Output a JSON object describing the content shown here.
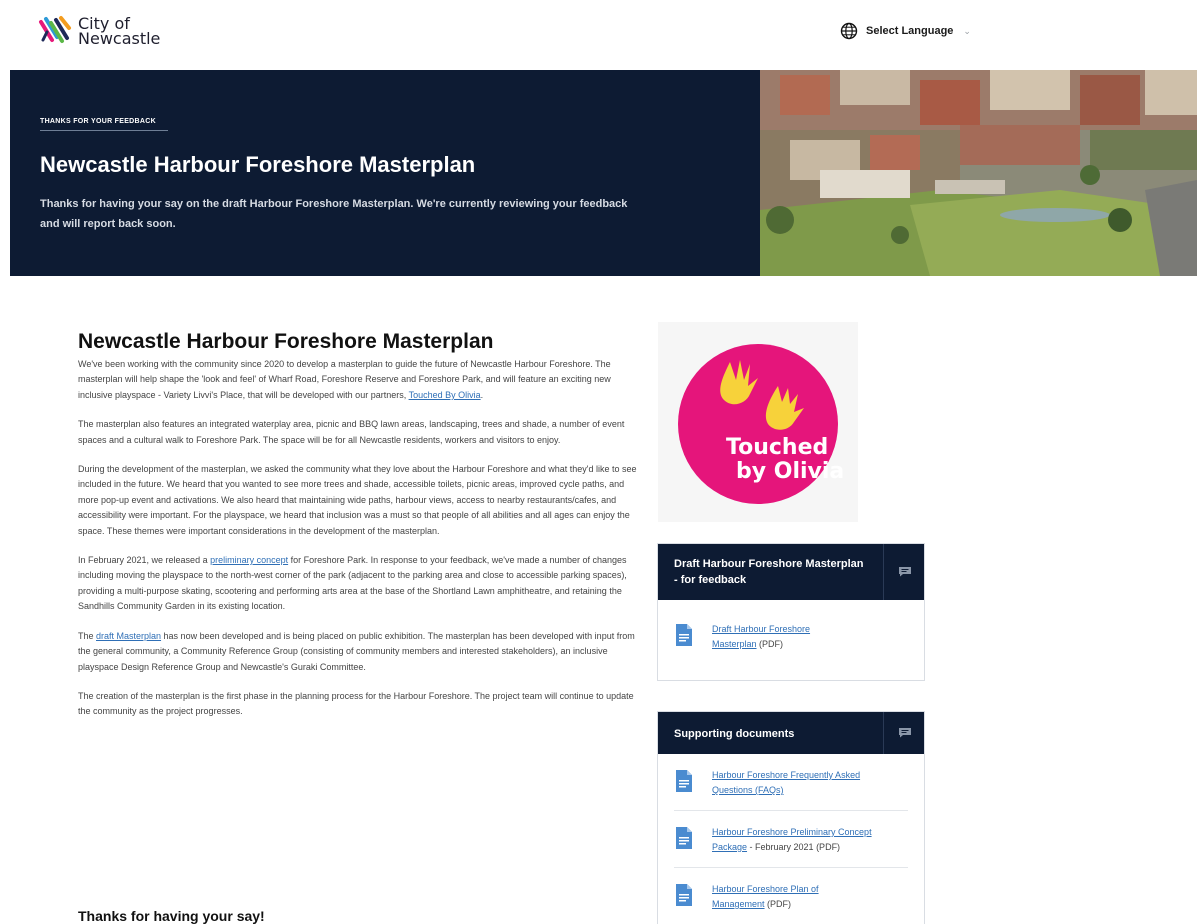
{
  "header": {
    "logo_line1": "City of",
    "logo_line2": "Newcastle",
    "language_label": "Select Language"
  },
  "hero": {
    "eyebrow": "THANKS FOR YOUR FEEDBACK",
    "title": "Newcastle Harbour Foreshore Masterplan",
    "subtitle": "Thanks for having your say on the draft Harbour Foreshore Masterplan. We're currently reviewing your feedback and will report back soon."
  },
  "main": {
    "title": "Newcastle Harbour Foreshore Masterplan",
    "p1_text": "We've been working with the community since 2020 to develop a masterplan to guide the future of Newcastle Harbour Foreshore. The masterplan will help shape the 'look and feel' of Wharf Road, Foreshore Reserve and Foreshore Park, and will feature an exciting new inclusive playspace - Variety Livvi's Place, that will be developed with our partners, ",
    "p1_link": "Touched By Olivia",
    "p1_end": ".",
    "p2": "The masterplan also features an integrated waterplay area, picnic and BBQ lawn areas, landscaping, trees and shade, a number of event spaces and a cultural walk to Foreshore Park. The space will be for all Newcastle residents, workers and visitors to enjoy.",
    "p3": "During the development of the masterplan, we asked the community what they love about the Harbour Foreshore and what they'd like to see included in the future. We heard that you wanted to see more trees and shade, accessible toilets, picnic areas, improved cycle paths, and more pop-up event and activations. We also heard that maintaining wide paths, harbour views, access to nearby restaurants/cafes, and accessibility were important. For the playspace, we heard that inclusion was a must so that people of all abilities and all ages can enjoy the space. These themes were important considerations in the development of the masterplan.",
    "p4_start": "In February 2021, we released a ",
    "p4_link": "preliminary concept",
    "p4_end": " for Foreshore Park. In response to your feedback, we've made a number of changes including moving the playspace to the north-west corner of the park (adjacent to the parking area and close to accessible parking spaces), providing a multi-purpose skating, scootering and performing arts area at the base of the Shortland Lawn amphitheatre, and retaining the Sandhills Community Garden in its existing location.",
    "p5_start": "The ",
    "p5_link": "draft Masterplan",
    "p5_end": " has now been developed and is being placed on public exhibition. The masterplan has been developed with input from the general community, a Community Reference Group (consisting of community members and interested stakeholders), an inclusive playspace Design Reference Group and Newcastle's Guraki Committee.",
    "p6": "The creation of the masterplan is the first phase in the planning process for the Harbour Foreshore. The project team will continue to update the community as the project progresses.",
    "thanks_heading": "Thanks for having your say!"
  },
  "sidebar": {
    "olivia_logo_text_1": "Touched",
    "olivia_logo_text_2": "by Olivia",
    "feedback_card": {
      "title": "Draft Harbour Foreshore Masterplan - for feedback",
      "docs": [
        {
          "link": "Draft Harbour Foreshore Masterplan",
          "suffix": " (PDF)"
        }
      ]
    },
    "supporting_card": {
      "title": "Supporting documents",
      "docs": [
        {
          "link": "Harbour Foreshore Frequently Asked Questions (FAQs)",
          "suffix": ""
        },
        {
          "link": "Harbour Foreshore Preliminary Concept Package",
          "suffix": " - February 2021 (PDF)"
        },
        {
          "link": "Harbour Foreshore Plan of Management",
          "suffix": " (PDF)"
        }
      ]
    }
  },
  "colors": {
    "navy": "#0d1b33",
    "link": "#2f6fb6",
    "olivia_pink": "#e5157b",
    "olivia_yellow": "#f7d23a"
  }
}
